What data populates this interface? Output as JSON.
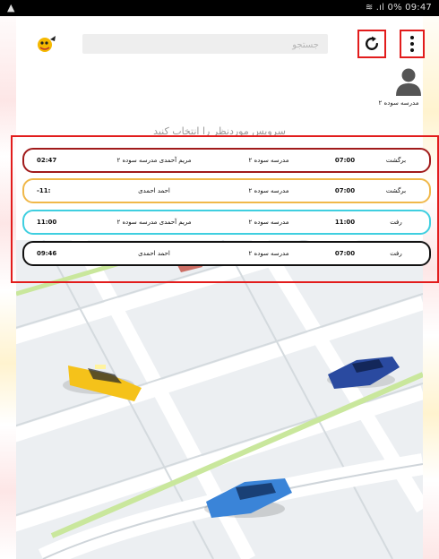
{
  "status_bar": {
    "right_text": "0% 09:47"
  },
  "search": {
    "placeholder": "جستجو"
  },
  "school": {
    "name": "مدرسه سوده ۲"
  },
  "prompt": "سرویس موردنظر را انتخاب کنید",
  "trips": [
    {
      "type": "برگشت",
      "time": "07:00",
      "school": "مدرسه سوده ۲",
      "students": "مریم آحمدی مدرسه سوده ۲",
      "time_right": "02:47",
      "border_color": "#a11b1b"
    },
    {
      "type": "برگشت",
      "time": "07:00",
      "school": "مدرسه سوده ۲",
      "students": "احمد احمدی",
      "time_right": "-11:",
      "border_color": "#f0b84a"
    },
    {
      "type": "رفت",
      "time": "11:00",
      "school": "مدرسه سوده ۲",
      "students": "مریم آحمدی مدرسه سوده ۲",
      "time_right": "11:00",
      "border_color": "#3fcfe0"
    },
    {
      "type": "رفت",
      "time": "07:00",
      "school": "مدرسه سوده ۲",
      "students": "احمد احمدی",
      "time_right": "09:46",
      "border_color": "#111111"
    }
  ],
  "colors": {
    "highlight": "#e21c1c",
    "taxi": "#f5c21a",
    "car_blue": "#2a4aa0",
    "car_light_blue": "#3a84d8"
  }
}
